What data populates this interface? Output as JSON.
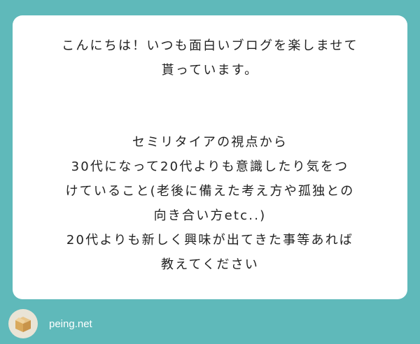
{
  "question": {
    "greeting_lines": [
      "こんにちは！いつも面白いブログを楽しませて",
      "貰っています。"
    ],
    "body_lines": [
      "セミリタイアの視点から",
      "30代になって20代よりも意識したり気をつ",
      "けていること(老後に備えた考え方や孤独との",
      "向き合い方etc..)",
      "20代よりも新しく興味が出てきた事等あれば",
      "教えてください"
    ]
  },
  "footer": {
    "brand": "peing.net",
    "logo_icon": "cardboard-box-icon"
  },
  "colors": {
    "background": "#5fb9ba",
    "card": "#ffffff",
    "text": "#222222",
    "brand_text": "#ffffff"
  }
}
